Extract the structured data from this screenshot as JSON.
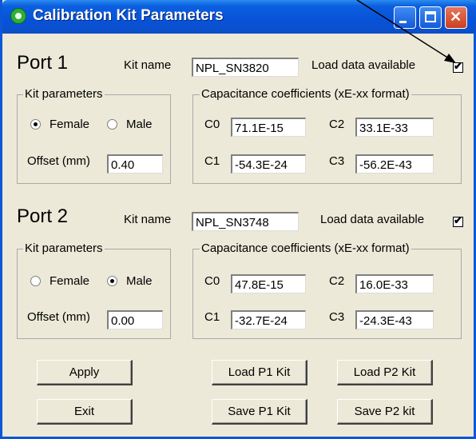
{
  "window": {
    "title": "Calibration Kit Parameters"
  },
  "port1": {
    "title": "Port 1",
    "kit_name_label": "Kit name",
    "kit_name_value": "NPL_SN3820",
    "load_label": "Load data available",
    "load_checked": true,
    "kit_params_title": "Kit parameters",
    "female_label": "Female",
    "male_label": "Male",
    "selected": "Female",
    "offset_label": "Offset (mm)",
    "offset_value": "0.40",
    "cap_title": "Capacitance coefficients (xE-xx format)",
    "c0_label": "C0",
    "c0_value": "71.1E-15",
    "c1_label": "C1",
    "c1_value": "-54.3E-24",
    "c2_label": "C2",
    "c2_value": "33.1E-33",
    "c3_label": "C3",
    "c3_value": "-56.2E-43"
  },
  "port2": {
    "title": "Port 2",
    "kit_name_label": "Kit name",
    "kit_name_value": "NPL_SN3748",
    "load_label": "Load data available",
    "load_checked": true,
    "kit_params_title": "Kit parameters",
    "female_label": "Female",
    "male_label": "Male",
    "selected": "Male",
    "offset_label": "Offset (mm)",
    "offset_value": "0.00",
    "cap_title": "Capacitance coefficients (xE-xx format)",
    "c0_label": "C0",
    "c0_value": "47.8E-15",
    "c1_label": "C1",
    "c1_value": "-32.7E-24",
    "c2_label": "C2",
    "c2_value": "16.0E-33",
    "c3_label": "C3",
    "c3_value": "-24.3E-43"
  },
  "buttons": {
    "apply": "Apply",
    "exit": "Exit",
    "load_p1": "Load P1 Kit",
    "load_p2": "Load P2 Kit",
    "save_p1": "Save P1 Kit",
    "save_p2": "Save P2 kit"
  }
}
